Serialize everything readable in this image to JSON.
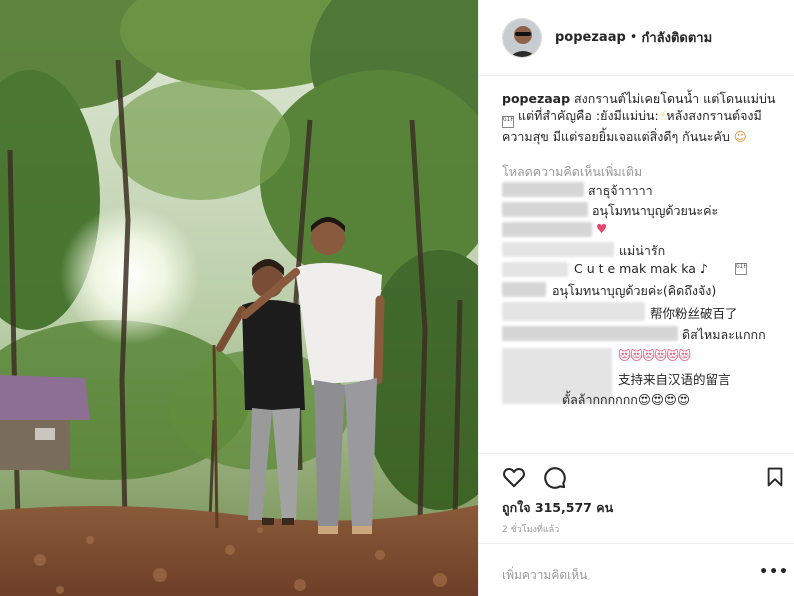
{
  "post": {
    "username": "popezaap",
    "separator": "•",
    "follow_label": "กำลังติดตาม",
    "caption_user": "popezaap",
    "caption_1": "สงกรานต์ไม่เคยโดนน้ำ แต่โดนแม่บ่น",
    "caption_2": "แต่ที่สำคัญคือ :ยังมีแม่บ่น:",
    "caption_3": "หลังสงกรานต์จงมีความสุข มีแต่รอยยิ้มเจอแต่สิ่งดีๆ กันนะคับ",
    "load_more": "โหลดความคิดเห็นเพิ่มเติม",
    "likes_label": "ถูกใจ 315,577 คน",
    "time_ago": "2 ชั่วโมงที่แล้ว",
    "add_comment_placeholder": "เพิ่มความคิดเห็น",
    "more_options": "•••"
  },
  "comments": [
    {
      "text": "สาธุจ้าาาาา"
    },
    {
      "text": "อนุโมทนาบุญด้วยนะค่ะ"
    },
    {
      "text": "♥"
    },
    {
      "text": "แม่น่ารัก"
    },
    {
      "text": "C u t e mak mak ka ♪"
    },
    {
      "text": "อนุโมทนาบุญด้วยค่ะ(คิดถึงจัง)"
    },
    {
      "text": "帮你粉丝破百了"
    },
    {
      "text": "ดิสไหมละแกกก"
    },
    {
      "text": "😻😻😻😻😻😻"
    },
    {
      "text": "支持来自汉语的留言"
    },
    {
      "text": "ตั้ลล้ากกกกกก😍😍😍😍"
    }
  ],
  "icons": {
    "heart": "heart-outline-icon",
    "comment": "comment-bubble-icon",
    "save": "bookmark-icon",
    "options": "ellipsis-icon"
  },
  "colors": {
    "text": "#262626",
    "muted": "#999999",
    "border": "#efefef",
    "heart_emoji": "#e8416a"
  }
}
